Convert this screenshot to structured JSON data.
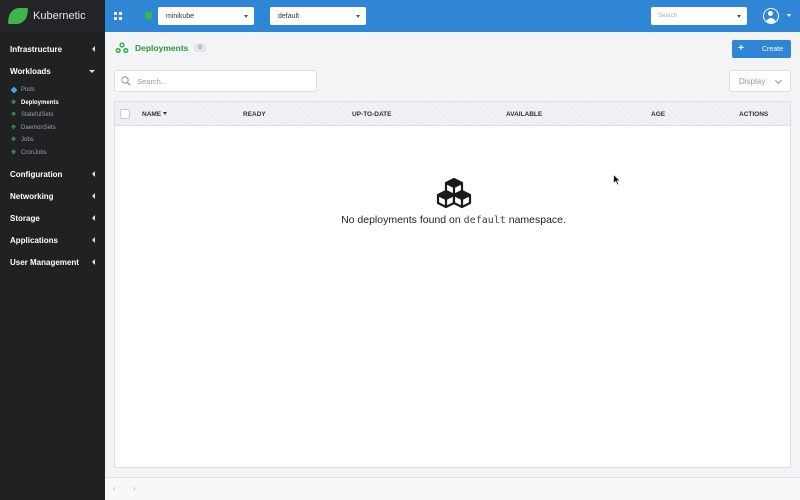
{
  "brand": {
    "name": "Kubernetic"
  },
  "sidebar": {
    "groups": [
      {
        "label": "Infrastructure"
      },
      {
        "label": "Workloads"
      },
      {
        "label": "Configuration"
      },
      {
        "label": "Networking"
      },
      {
        "label": "Storage"
      },
      {
        "label": "Applications"
      },
      {
        "label": "User Management"
      }
    ],
    "workloads_items": [
      {
        "label": "Pods",
        "icon": "pod-icon"
      },
      {
        "label": "Deployments",
        "icon": "cluster-icon",
        "active": true
      },
      {
        "label": "StatefulSets",
        "icon": "cluster-icon"
      },
      {
        "label": "DaemonSets",
        "icon": "cluster-icon"
      },
      {
        "label": "Jobs",
        "icon": "cluster-icon"
      },
      {
        "label": "CronJobs",
        "icon": "cluster-icon"
      }
    ]
  },
  "topbar": {
    "context": "minikube",
    "namespace": "default",
    "search_placeholder": "Search"
  },
  "page": {
    "title": "Deployments",
    "count": "0",
    "create_label": "Create",
    "search_placeholder": "Search...",
    "display_label": "Display"
  },
  "table": {
    "columns": [
      "NAME",
      "READY",
      "UP-TO-DATE",
      "AVAILABLE",
      "AGE",
      "ACTIONS"
    ]
  },
  "empty": {
    "prefix": "No deployments found on ",
    "namespace": "default",
    "suffix": " namespace."
  },
  "footer": {
    "prev": "‹",
    "next": "›"
  },
  "colors": {
    "topbar": "#2e86d4",
    "sidebar": "#1f2123",
    "accent_green": "#3cb54a"
  }
}
